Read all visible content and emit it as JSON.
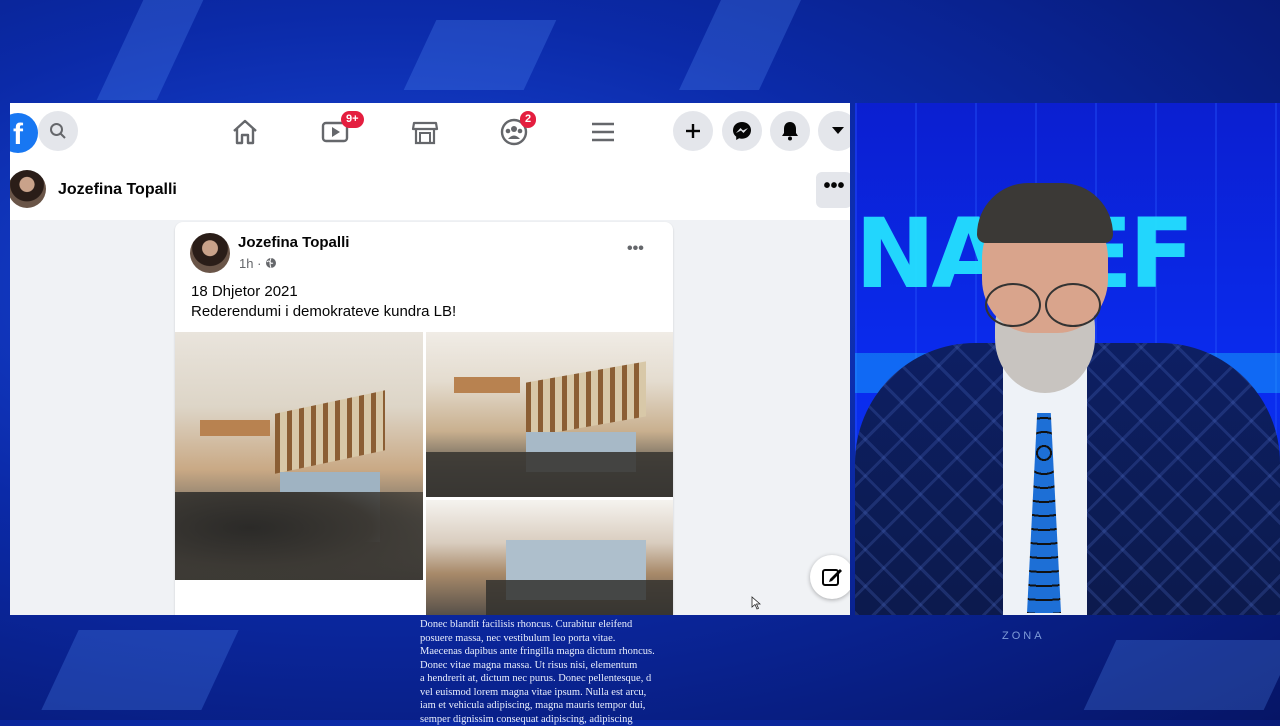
{
  "topbar": {
    "logo_letter": "f",
    "video_badge": "9+",
    "groups_badge": "2"
  },
  "profile_bar": {
    "name": "Jozefina Topalli",
    "more": "•••"
  },
  "post": {
    "author": "Jozefina Topalli",
    "meta_time": "1h ·",
    "more": "•••",
    "line1": "18 Dhjetor 2021",
    "line2": "Rederendumi i demokrateve kundra LB!"
  },
  "studio": {
    "big_word": "NAZEF",
    "zona_label": "ZONA"
  },
  "overlay_text": [
    "Donec blandit facilisis rhoncus. Curabitur eleifend",
    "posuere massa, nec vestibulum leo porta vitae.",
    "Maecenas dapibus ante fringilla magna dictum rhoncus.",
    "Donec vitae magna massa. Ut risus nisi, elementum",
    "a hendrerit at, dictum nec purus. Donec pellentesque, d",
    "vel euismod lorem magna vitae ipsum. Nulla est arcu,",
    "iam et vehicula adipiscing, magna mauris tempor dui,",
    "semper dignissim consequat adipiscing, adipiscing"
  ],
  "colors": {
    "fb_blue": "#1877f2",
    "badge_red": "#e41e3f",
    "studio_cyan": "#24e0ff"
  }
}
